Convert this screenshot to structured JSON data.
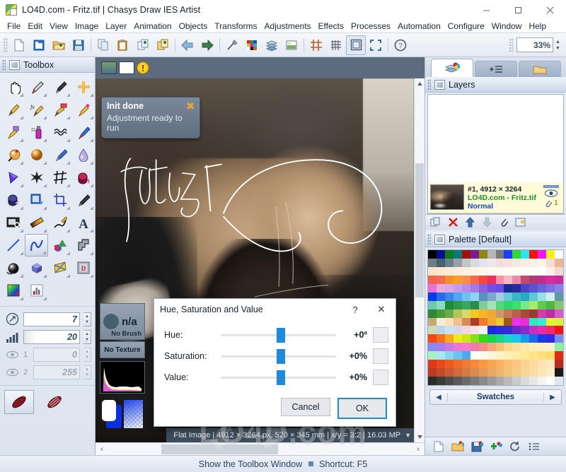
{
  "window": {
    "title": "LO4D.com - Fritz.tif | Chasys Draw IES Artist",
    "app_icon": "chasys-logo-icon",
    "minimize": "—",
    "maximize": "☐",
    "close": "✕"
  },
  "menubar": {
    "items": [
      "File",
      "Edit",
      "View",
      "Image",
      "Layer",
      "Animation",
      "Objects",
      "Transforms",
      "Adjustments",
      "Effects",
      "Processes",
      "Automation",
      "Configure",
      "Window",
      "Help"
    ]
  },
  "toolbar": {
    "zoom_value": "33%",
    "buttons": [
      {
        "name": "new-document-icon",
        "title": "New"
      },
      {
        "name": "new-from-clipboard-icon",
        "title": "New from clipboard"
      },
      {
        "name": "open-folder-icon",
        "title": "Open"
      },
      {
        "name": "save-icon",
        "title": "Save"
      },
      {
        "name": "copy-icon",
        "title": "Copy"
      },
      {
        "name": "paste-icon",
        "title": "Paste"
      },
      {
        "name": "duplicate-layer-icon",
        "title": "Duplicate layer"
      },
      {
        "name": "import-layer-icon",
        "title": "Import layer"
      },
      {
        "name": "undo-icon",
        "title": "Undo"
      },
      {
        "name": "redo-icon",
        "title": "Redo"
      },
      {
        "name": "magic-wand-icon",
        "title": "Magic wand"
      },
      {
        "name": "color-palette-icon",
        "title": "Palette"
      },
      {
        "name": "layers-icon",
        "title": "Layers"
      },
      {
        "name": "image-properties-icon",
        "title": "Image"
      },
      {
        "name": "canvas-size-icon",
        "title": "Canvas size"
      },
      {
        "name": "grid-icon",
        "title": "Grid"
      },
      {
        "name": "fit-window-icon",
        "title": "Fit to window"
      },
      {
        "name": "fullscreen-icon",
        "title": "Full screen"
      },
      {
        "name": "help-icon",
        "title": "Help"
      }
    ]
  },
  "toolbox": {
    "title": "Toolbox",
    "tools": [
      {
        "name": "pointer-hand-tool",
        "glyph": "☚"
      },
      {
        "name": "pencil-tool",
        "glyph": "✎"
      },
      {
        "name": "eyedropper-pen-tool",
        "glyph": "✒"
      },
      {
        "name": "crosshair-tool",
        "glyph": "✚"
      },
      {
        "name": "paintbrush-tool",
        "glyph": "✐"
      },
      {
        "name": "effects-brush-tool",
        "glyph": "fx"
      },
      {
        "name": "pattern-brush-tool",
        "glyph": "✐"
      },
      {
        "name": "add-brush-tool",
        "glyph": "✐"
      },
      {
        "name": "texture-brush-tool",
        "glyph": "✐"
      },
      {
        "name": "spray-can-tool",
        "glyph": "⚈"
      },
      {
        "name": "smudge-wave-tool",
        "glyph": "≈"
      },
      {
        "name": "airbrush-tool",
        "glyph": "✒"
      },
      {
        "name": "blend-ball-tool",
        "glyph": "●"
      },
      {
        "name": "sphere-gradient-tool",
        "glyph": "●"
      },
      {
        "name": "marker-pen-tool",
        "glyph": "✒"
      },
      {
        "name": "water-drop-tool",
        "glyph": "Ὂ7"
      },
      {
        "name": "cone-shade-tool",
        "glyph": "▶"
      },
      {
        "name": "star-burst-tool",
        "glyph": "✳"
      },
      {
        "name": "hash-grid-tool",
        "glyph": "#"
      },
      {
        "name": "paint-bucket-tool",
        "glyph": "◔"
      },
      {
        "name": "spray-fill-tool",
        "glyph": "◔"
      },
      {
        "name": "gradient-fill-tool",
        "glyph": "▣"
      },
      {
        "name": "crop-tool",
        "glyph": "⌧"
      },
      {
        "name": "color-picker-tool",
        "glyph": "✒"
      },
      {
        "name": "selection-zoom-tool",
        "glyph": "▣"
      },
      {
        "name": "gradient-ramp-tool",
        "glyph": "▰"
      },
      {
        "name": "curve-pen-tool",
        "glyph": "✒"
      },
      {
        "name": "text-tool",
        "glyph": "A"
      },
      {
        "name": "line-tool",
        "glyph": "╱"
      },
      {
        "name": "freehand-curve-tool",
        "glyph": "N"
      },
      {
        "name": "shapes-tool",
        "glyph": "▲"
      },
      {
        "name": "polygon-tool",
        "glyph": "⬟"
      },
      {
        "name": "sphere-3d-tool",
        "glyph": "●"
      },
      {
        "name": "cube-3d-tool",
        "glyph": "■"
      },
      {
        "name": "mesh-warp-tool",
        "glyph": "◈"
      },
      {
        "name": "stamp-tool",
        "glyph": "D"
      },
      {
        "name": "color-square-tool",
        "glyph": "▣"
      },
      {
        "name": "histogram-tool",
        "glyph": "█"
      }
    ],
    "active_tool": "freehand-curve-tool",
    "size_value": "7",
    "strength_value": "20",
    "alpha1_label": "1",
    "alpha1_value": "0",
    "alpha2_label": "2",
    "alpha2_value": "255",
    "brush_mode": [
      "solid-brush-icon",
      "textured-brush-icon"
    ]
  },
  "canvas": {
    "controls": [
      "image-preview-toggle",
      "white-background-toggle",
      "warning-indicator"
    ],
    "notification": {
      "title": "Init done",
      "message": "Adjustment ready to run",
      "close": "✖"
    },
    "brush_preview": {
      "value": "n/a",
      "label": "No Brush",
      "texture_label": "No Texture"
    },
    "status": "Flat Image | 4912 × 3264 px, 520 × 345 mm | x/y = 3:2 | 16.03 MP",
    "annotation_text": "fritz"
  },
  "dialog": {
    "title": "Hue, Saturation and Value",
    "help": "?",
    "close": "✕",
    "sliders": [
      {
        "label": "Hue:",
        "value": "+0º",
        "pos": 50
      },
      {
        "label": "Saturation:",
        "value": "+0%",
        "pos": 50
      },
      {
        "label": "Value:",
        "value": "+0%",
        "pos": 50
      }
    ],
    "cancel_label": "Cancel",
    "ok_label": "OK",
    "accent": "#1d8ae0"
  },
  "right_panel": {
    "tabs": [
      {
        "name": "tab-layers",
        "icon": "layers-color-icon",
        "active": true
      },
      {
        "name": "tab-objects",
        "icon": "objects-list-icon",
        "active": false
      },
      {
        "name": "tab-files",
        "icon": "folder-icon",
        "active": false
      }
    ],
    "layers_title": "Layers",
    "layer": {
      "line1": "#1, 4912 × 3264",
      "line2": "LO4D.com - Fritz.tif",
      "line3": "Normal",
      "attachment_count": "1"
    },
    "layer_tools": [
      {
        "name": "duplicate-layer-button",
        "glyph": "⧉"
      },
      {
        "name": "delete-layer-button",
        "glyph": "✕"
      },
      {
        "name": "move-layer-up-button",
        "glyph": "▲"
      },
      {
        "name": "move-layer-down-button",
        "glyph": "▼"
      },
      {
        "name": "attach-layer-button",
        "glyph": "ὌE"
      },
      {
        "name": "layer-properties-button",
        "glyph": "▣"
      }
    ],
    "palette_title": "Palette [Default]",
    "swatches_label": "Swatches",
    "swatch_prev": "◀",
    "swatch_next": "▶",
    "bottom_tools": [
      {
        "name": "new-palette-button",
        "glyph": "□"
      },
      {
        "name": "open-palette-button",
        "glyph": "Ὄ2"
      },
      {
        "name": "save-palette-button",
        "glyph": "ὋE"
      },
      {
        "name": "add-color-button",
        "glyph": "✚"
      },
      {
        "name": "reset-palette-button",
        "glyph": "⟳"
      },
      {
        "name": "palette-list-button",
        "glyph": "☰"
      }
    ]
  },
  "statusbar": {
    "text_main": "Show the Toolbox Window",
    "separator": "■",
    "text_shortcut": "Shortcut: F5"
  },
  "watermark": {
    "text": "LO4D.com"
  },
  "palette_colors": [
    "#000000",
    "#0b0b8e",
    "#0e7a1e",
    "#0e7a78",
    "#9e1212",
    "#7a1b8e",
    "#8a8a14",
    "#b6b6b6",
    "#7a7a7a",
    "#1a3ef0",
    "#2ed63a",
    "#2ee5e5",
    "#f21212",
    "#f216f2",
    "#f2f21c",
    "#ffffff",
    "#6e7d86",
    "#46616e",
    "#69818f",
    "#9aa1a6",
    "#c0c5c8",
    "#d7dbdd",
    "#e4e3ef",
    "#f2e7ea",
    "#f4dcdc",
    "#f6e2dd",
    "#f7e8e0",
    "#f9ece3",
    "#fbf0e6",
    "#fdf4ea",
    "#f6ddd2",
    "#eab896",
    "#fae3c6",
    "#fbe8cf",
    "#fcead4",
    "#fdeedb",
    "#fdf1e0",
    "#fef4e6",
    "#fef6ea",
    "#fff8ee",
    "#fff9f1",
    "#fffaf4",
    "#fffbf6",
    "#fffcf8",
    "#fffdfa",
    "#fffefc",
    "#fcf1ea",
    "#f3d9cf",
    "#f5634f",
    "#f26a55",
    "#f58f2a",
    "#f99b2f",
    "#fb8d4a",
    "#f6684f",
    "#f24a3a",
    "#ee2e62",
    "#f590a6",
    "#f7b7c3",
    "#e98aa0",
    "#c14a6e",
    "#b03a78",
    "#c02f8e",
    "#d32fa0",
    "#c72e99",
    "#e870d8",
    "#e8a8d8",
    "#d9a6ea",
    "#c79ae8",
    "#b98ae6",
    "#a678e2",
    "#8d5ee0",
    "#7b4ce0",
    "#6a4ce6",
    "#1a2a8e",
    "#2a2a9e",
    "#4a45c8",
    "#5a52d0",
    "#6a62d8",
    "#7a72e0",
    "#8a82e8",
    "#0a3ae8",
    "#2a6ae8",
    "#3a86ea",
    "#4ea6ee",
    "#6ec2f2",
    "#8dd2f5",
    "#5a90c0",
    "#7aa8cc",
    "#a6cce0",
    "#6ac6d8",
    "#3ab6c8",
    "#2aa8be",
    "#5ec8d2",
    "#9ae0e4",
    "#cdeff1",
    "#5e9aa2",
    "#6ec8ae",
    "#88dcc0",
    "#1e8a3e",
    "#2e9a4e",
    "#3aa65e",
    "#2a8a52",
    "#7ecc9a",
    "#a8e0b8",
    "#52d67a",
    "#2ed66a",
    "#3ae06e",
    "#7ae88a",
    "#a8e86e",
    "#62c84e",
    "#4eb83e",
    "#86c86a",
    "#2e8a2e",
    "#4a9a3a",
    "#6aaa4a",
    "#b8c45a",
    "#d8d86a",
    "#f2c81e",
    "#f5b62a",
    "#f0a63a",
    "#c89a6a",
    "#c8785a",
    "#b8604a",
    "#a84a3a",
    "#9a3a2e",
    "#d63aa8",
    "#b82ea8",
    "#d65ac8",
    "#c8a87a",
    "#f6edd8",
    "#f8e0b8",
    "#f0c08a",
    "#d68a5a",
    "#b03a2a",
    "#f07a2a",
    "#f5a82a",
    "#f0c82a",
    "#9a5a1a",
    "#f22ef2",
    "#e82ed6",
    "#2ee8b8",
    "#3ae8d6",
    "#e8f22e",
    "#d6f23a",
    "#c8e0b8",
    "#b8d6e8",
    "#cce0f2",
    "#d6d6ee",
    "#f2d6e0",
    "#f8e0ea",
    "#f0f4fa",
    "#1a2ae8",
    "#2a2ae0",
    "#3a2ad6",
    "#6a2ac8",
    "#8a2ac8",
    "#c82ac8",
    "#e82aa8",
    "#f22a6a",
    "#f21212",
    "#f24a12",
    "#f5701a",
    "#f8a81a",
    "#f2e81a",
    "#c8e81a",
    "#86e01a",
    "#3ad61a",
    "#1ad64a",
    "#1ad686",
    "#1ad6c8",
    "#1ac8e8",
    "#1a9ae8",
    "#1a6ae8",
    "#1a3ae8",
    "#2a2ae8",
    "#7a8aee",
    "#8a8aee",
    "#a67ae8",
    "#c87ae0",
    "#e87ad6",
    "#f27ac8",
    "#f27aa8",
    "#f58a8a",
    "#f6a87a",
    "#f8c07a",
    "#fad68a",
    "#fbe29a",
    "#fce8aa",
    "#fdeeba",
    "#fdf0c6",
    "#fdf2d0",
    "#8af2a8",
    "#a6f2c8",
    "#a6e8f2",
    "#86d6f2",
    "#6ac2f2",
    "#4eaaee",
    "#ffffff",
    "#fffdf0",
    "#fff8d8",
    "#fff4c8",
    "#fff0b8",
    "#ffeca8",
    "#ffe898",
    "#ffe488",
    "#ffe078",
    "#ffdc6a",
    "#e02a1a",
    "#e03a1a",
    "#e84a1a",
    "#ee5a22",
    "#f06a2a",
    "#f27a32",
    "#f58a3a",
    "#f69a46",
    "#f7a652",
    "#f8b262",
    "#f9be72",
    "#fac882",
    "#fbd292",
    "#fcdaa2",
    "#fde2b2",
    "#fee8c2",
    "#b82a1a",
    "#be3a22",
    "#c44a2a",
    "#ca5a32",
    "#d06a3a",
    "#d67a44",
    "#dc8a4e",
    "#e29a58",
    "#e8a862",
    "#eeb66c",
    "#f2c278",
    "#f5cc86",
    "#f8d694",
    "#fadea4",
    "#fce6b4",
    "#fdecc4",
    "#1a1a1a",
    "#2a2a2a",
    "#3a3a3a",
    "#4a4a4a",
    "#5a5a5a",
    "#6a6a6a",
    "#7a7a7a",
    "#8a8a8a",
    "#9a9a9a",
    "#aaaaaa",
    "#bababa",
    "#cacaca",
    "#dadada",
    "#e8e8e8",
    "#f4f4f4",
    "#ffffff"
  ]
}
